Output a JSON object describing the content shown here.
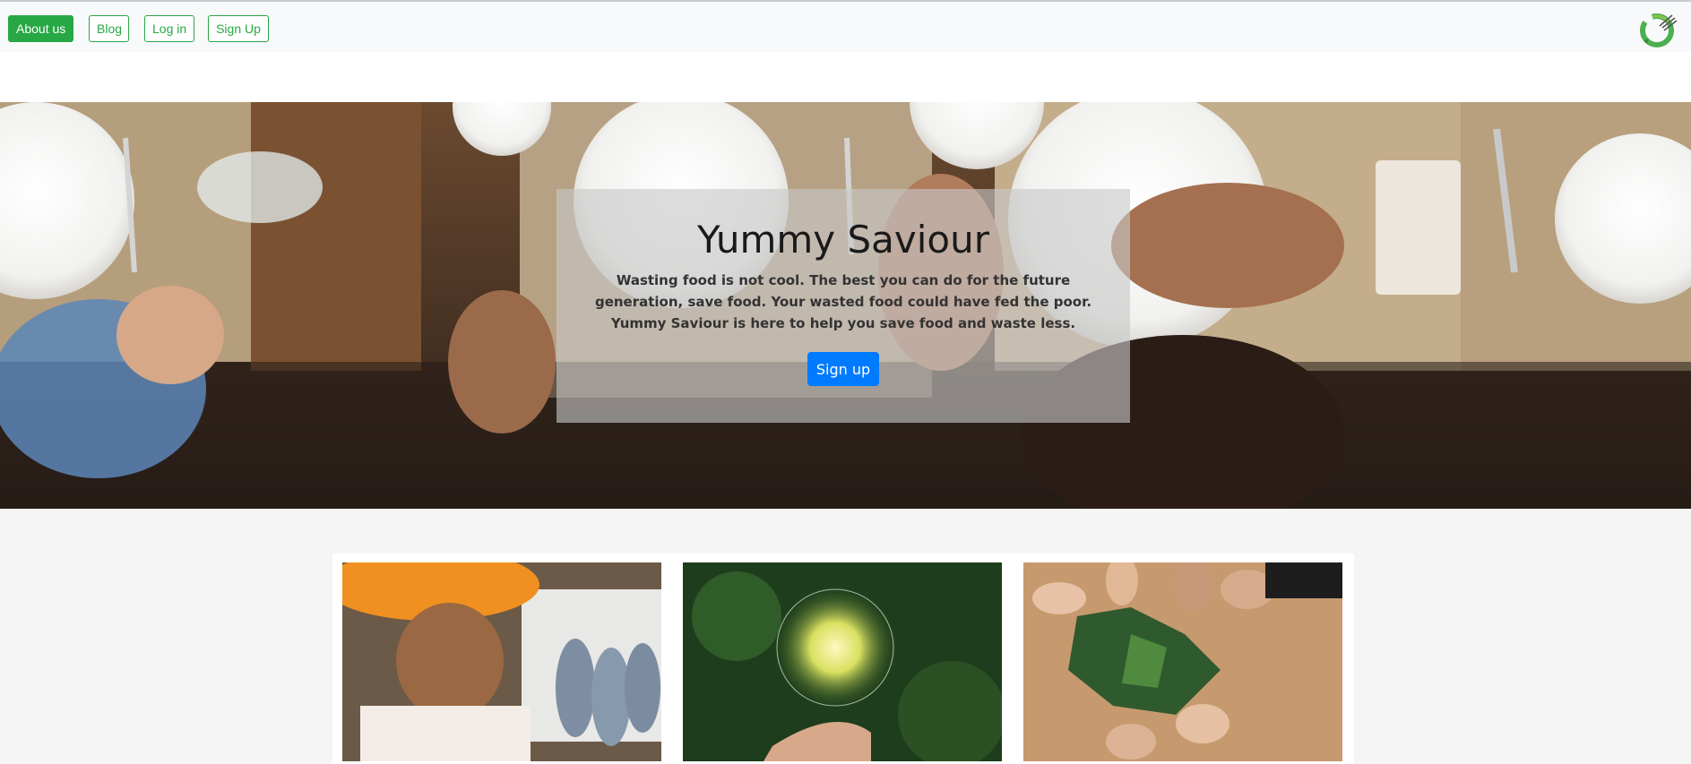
{
  "navbar": {
    "buttons": [
      {
        "label": "About us",
        "active": true
      },
      {
        "label": "Blog",
        "active": false
      },
      {
        "label": "Log in",
        "active": false
      },
      {
        "label": "Sign Up",
        "active": false
      }
    ],
    "logo_icon": "recycle-fork-logo-icon",
    "accent_color": "#28a745"
  },
  "hero": {
    "title": "Yummy Saviour",
    "text": "Wasting food is not cool. The best you can do for the future generation, save food. Your wasted food could have fed the poor. Yummy Saviour is here to help you save food and waste less.",
    "cta_label": "Sign up",
    "cta_color": "#007bff",
    "background_image": "dining-table-photo"
  },
  "cards": [
    {
      "image": "smiling-woman-with-fish-photo"
    },
    {
      "image": "lightbulb-in-hand-eco-icons-photo"
    },
    {
      "image": "hands-with-green-puzzle-photo"
    }
  ]
}
